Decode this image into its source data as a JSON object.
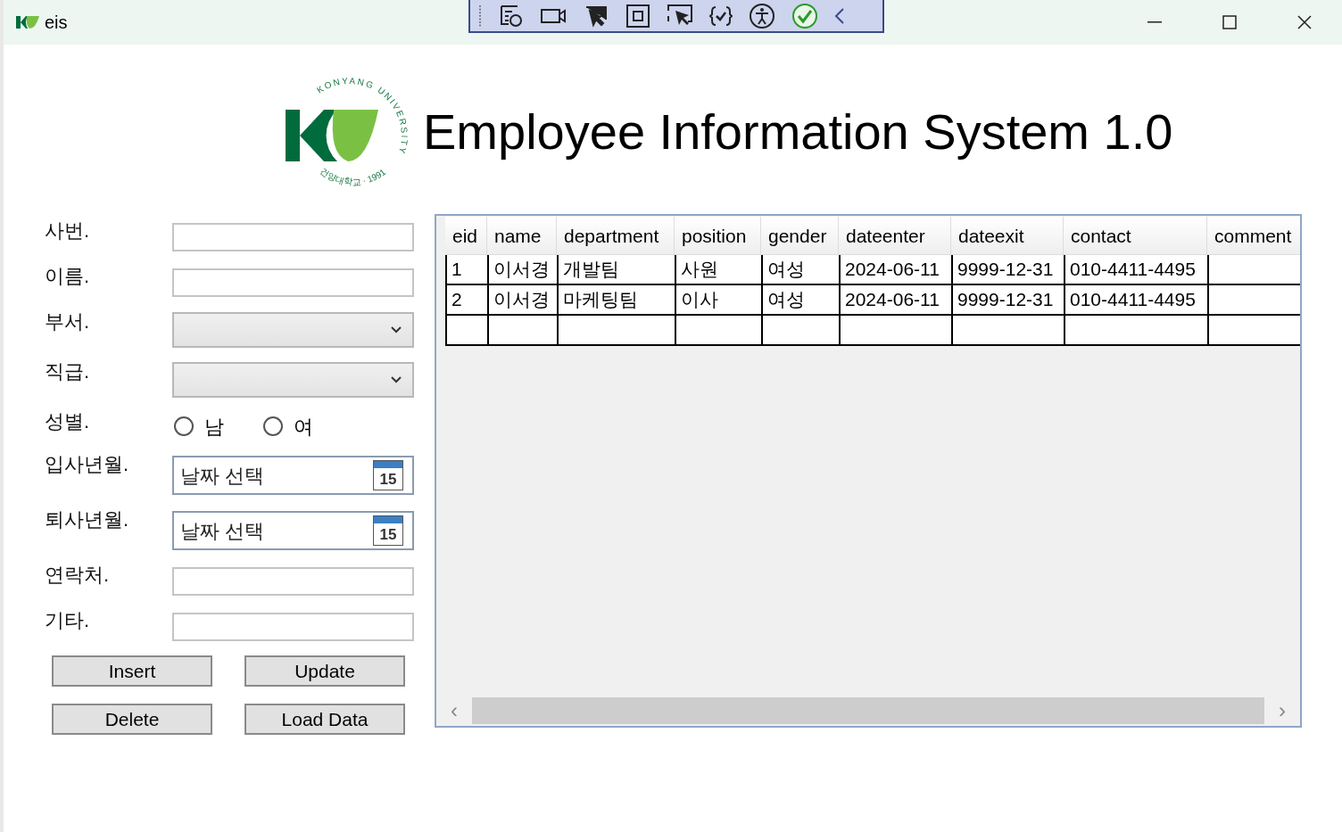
{
  "window": {
    "title": "eis"
  },
  "header": {
    "logo_top": "KONYANG UNIVERSITY",
    "logo_bottom": "건양대학교 · 1991",
    "title": "Employee Information System 1.0"
  },
  "form": [
    {
      "kind": "text",
      "label": "사번."
    },
    {
      "kind": "text",
      "label": "이름."
    },
    {
      "kind": "select",
      "label": "부서."
    },
    {
      "kind": "select",
      "label": "직급."
    },
    {
      "kind": "radio",
      "label": "성별.",
      "options": [
        {
          "label": "남",
          "selected": false
        },
        {
          "label": "여",
          "selected": false
        }
      ]
    },
    {
      "kind": "date",
      "label": "입사년월.",
      "placeholder": "날짜 선택",
      "icon_text": "15"
    },
    {
      "kind": "date",
      "label": "퇴사년월.",
      "placeholder": "날짜 선택",
      "icon_text": "15"
    },
    {
      "kind": "text",
      "label": "연락처."
    },
    {
      "kind": "text",
      "label": "기타."
    }
  ],
  "buttons": [
    "Insert",
    "Update",
    "Delete",
    "Load Data"
  ],
  "table": {
    "columns": [
      "eid",
      "name",
      "department",
      "position",
      "gender",
      "dateenter",
      "dateexit",
      "contact",
      "comment"
    ],
    "rows": [
      [
        "1",
        "이서경",
        "개발팀",
        "사원",
        "여성",
        "2024-06-11",
        "9999-12-31",
        "010-4411-4495"
      ],
      [
        "2",
        "이서경",
        "마케팅팀",
        "이사",
        "여성",
        "2024-06-11",
        "9999-12-31",
        "010-4411-4495"
      ]
    ],
    "scroll_left": "‹",
    "scroll_right": "›"
  }
}
